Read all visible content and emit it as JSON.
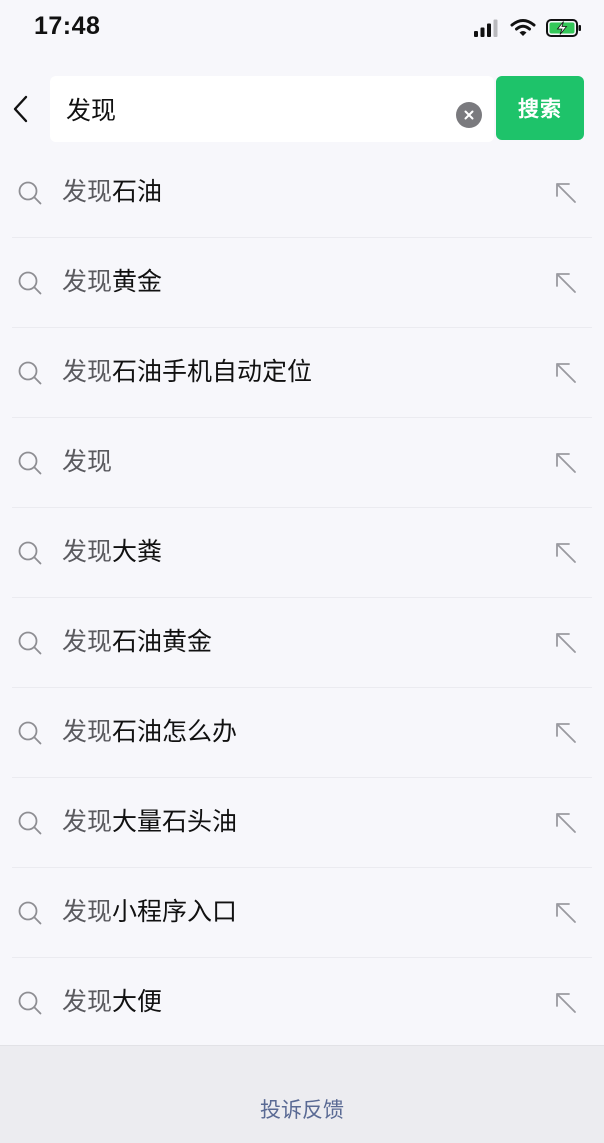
{
  "status_bar": {
    "time": "17:48"
  },
  "search": {
    "query": "发现",
    "button_label": "搜索"
  },
  "suggestions": [
    {
      "prefix": "发现",
      "rest": "石油"
    },
    {
      "prefix": "发现",
      "rest": "黄金"
    },
    {
      "prefix": "发现",
      "rest": "石油手机自动定位"
    },
    {
      "prefix": "发现",
      "rest": ""
    },
    {
      "prefix": "发现",
      "rest": "大粪"
    },
    {
      "prefix": "发现",
      "rest": "石油黄金"
    },
    {
      "prefix": "发现",
      "rest": "石油怎么办"
    },
    {
      "prefix": "发现",
      "rest": "大量石头油"
    },
    {
      "prefix": "发现",
      "rest": "小程序入口"
    },
    {
      "prefix": "发现",
      "rest": "大便"
    }
  ],
  "footer": {
    "feedback_label": "投诉反馈"
  },
  "icons": {
    "back": "back-chevron-icon",
    "clear": "clear-icon",
    "suggestion": "search-icon",
    "fill": "fill-arrow-icon",
    "signal": "signal-icon",
    "wifi": "wifi-icon",
    "battery": "battery-charging-icon"
  },
  "colors": {
    "accent": "#1ec36a",
    "link": "#5a6a94",
    "background": "#f7f7fb"
  }
}
